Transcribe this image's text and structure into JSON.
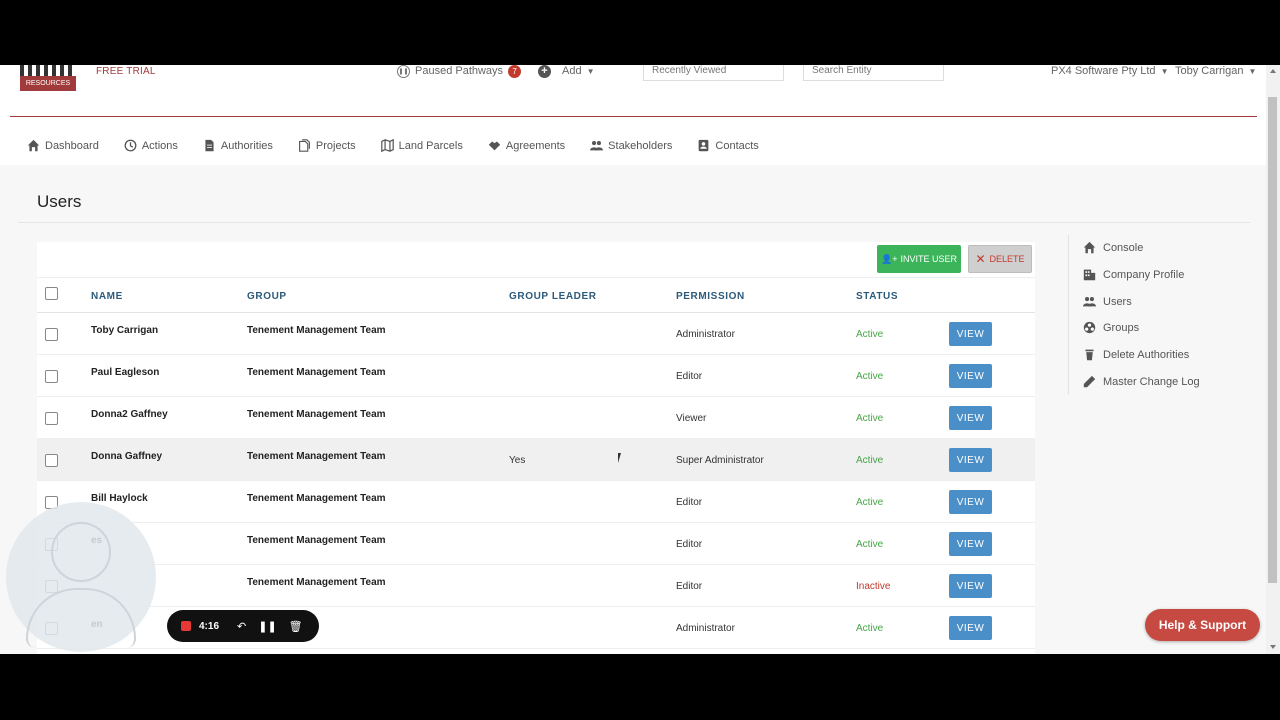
{
  "header": {
    "logo_text": "RESOURCES",
    "trial_label": "FREE TRIAL",
    "paused_label": "Paused Pathways",
    "paused_count": "7",
    "add_label": "Add",
    "recent_placeholder": "Recently Viewed",
    "search_placeholder": "Search Entity",
    "company_label": "PX4 Software Pty Ltd",
    "user_label": "Toby Carrigan"
  },
  "nav": [
    {
      "label": "Dashboard",
      "icon": "home-icon"
    },
    {
      "label": "Actions",
      "icon": "clock-icon"
    },
    {
      "label": "Authorities",
      "icon": "document-icon"
    },
    {
      "label": "Projects",
      "icon": "files-icon"
    },
    {
      "label": "Land Parcels",
      "icon": "map-icon"
    },
    {
      "label": "Agreements",
      "icon": "handshake-icon"
    },
    {
      "label": "Stakeholders",
      "icon": "people-icon"
    },
    {
      "label": "Contacts",
      "icon": "contact-card-icon"
    }
  ],
  "page": {
    "title": "Users",
    "invite_label": "INVITE USER",
    "delete_label": "DELETE"
  },
  "table": {
    "columns": [
      "NAME",
      "GROUP",
      "GROUP LEADER",
      "PERMISSION",
      "STATUS"
    ],
    "view_label": "VIEW",
    "rows": [
      {
        "name": "Toby Carrigan",
        "group": "Tenement Management Team",
        "leader": "",
        "permission": "Administrator",
        "status": "Active"
      },
      {
        "name": "Paul Eagleson",
        "group": "Tenement Management Team",
        "leader": "",
        "permission": "Editor",
        "status": "Active"
      },
      {
        "name": "Donna2 Gaffney",
        "group": "Tenement Management Team",
        "leader": "",
        "permission": "Viewer",
        "status": "Active"
      },
      {
        "name": "Donna Gaffney",
        "group": "Tenement Management Team",
        "leader": "Yes",
        "permission": "Super Administrator",
        "status": "Active"
      },
      {
        "name": "Bill Haylock",
        "group": "Tenement Management Team",
        "leader": "",
        "permission": "Editor",
        "status": "Active"
      },
      {
        "name": "es",
        "group": "Tenement Management Team",
        "leader": "",
        "permission": "Editor",
        "status": "Active"
      },
      {
        "name": "",
        "group": "Tenement Management Team",
        "leader": "",
        "permission": "Editor",
        "status": "Inactive"
      },
      {
        "name": "en",
        "group": "agement Team",
        "leader": "",
        "permission": "Administrator",
        "status": "Active"
      }
    ]
  },
  "side_menu": [
    {
      "label": "Console",
      "icon": "home-icon"
    },
    {
      "label": "Company Profile",
      "icon": "building-icon"
    },
    {
      "label": "Users",
      "icon": "people-icon"
    },
    {
      "label": "Groups",
      "icon": "groups-icon"
    },
    {
      "label": "Delete Authorities",
      "icon": "trash-icon"
    },
    {
      "label": "Master Change Log",
      "icon": "pencil-icon"
    }
  ],
  "help": {
    "label": "Help & Support"
  },
  "recorder": {
    "time": "4:16"
  },
  "colors": {
    "brand": "#a13a3a",
    "active": "#47a447",
    "inactive": "#c0392b",
    "view_button": "#4a8fc7",
    "invite_button": "#3cb55a",
    "help_button": "#c64a42"
  }
}
